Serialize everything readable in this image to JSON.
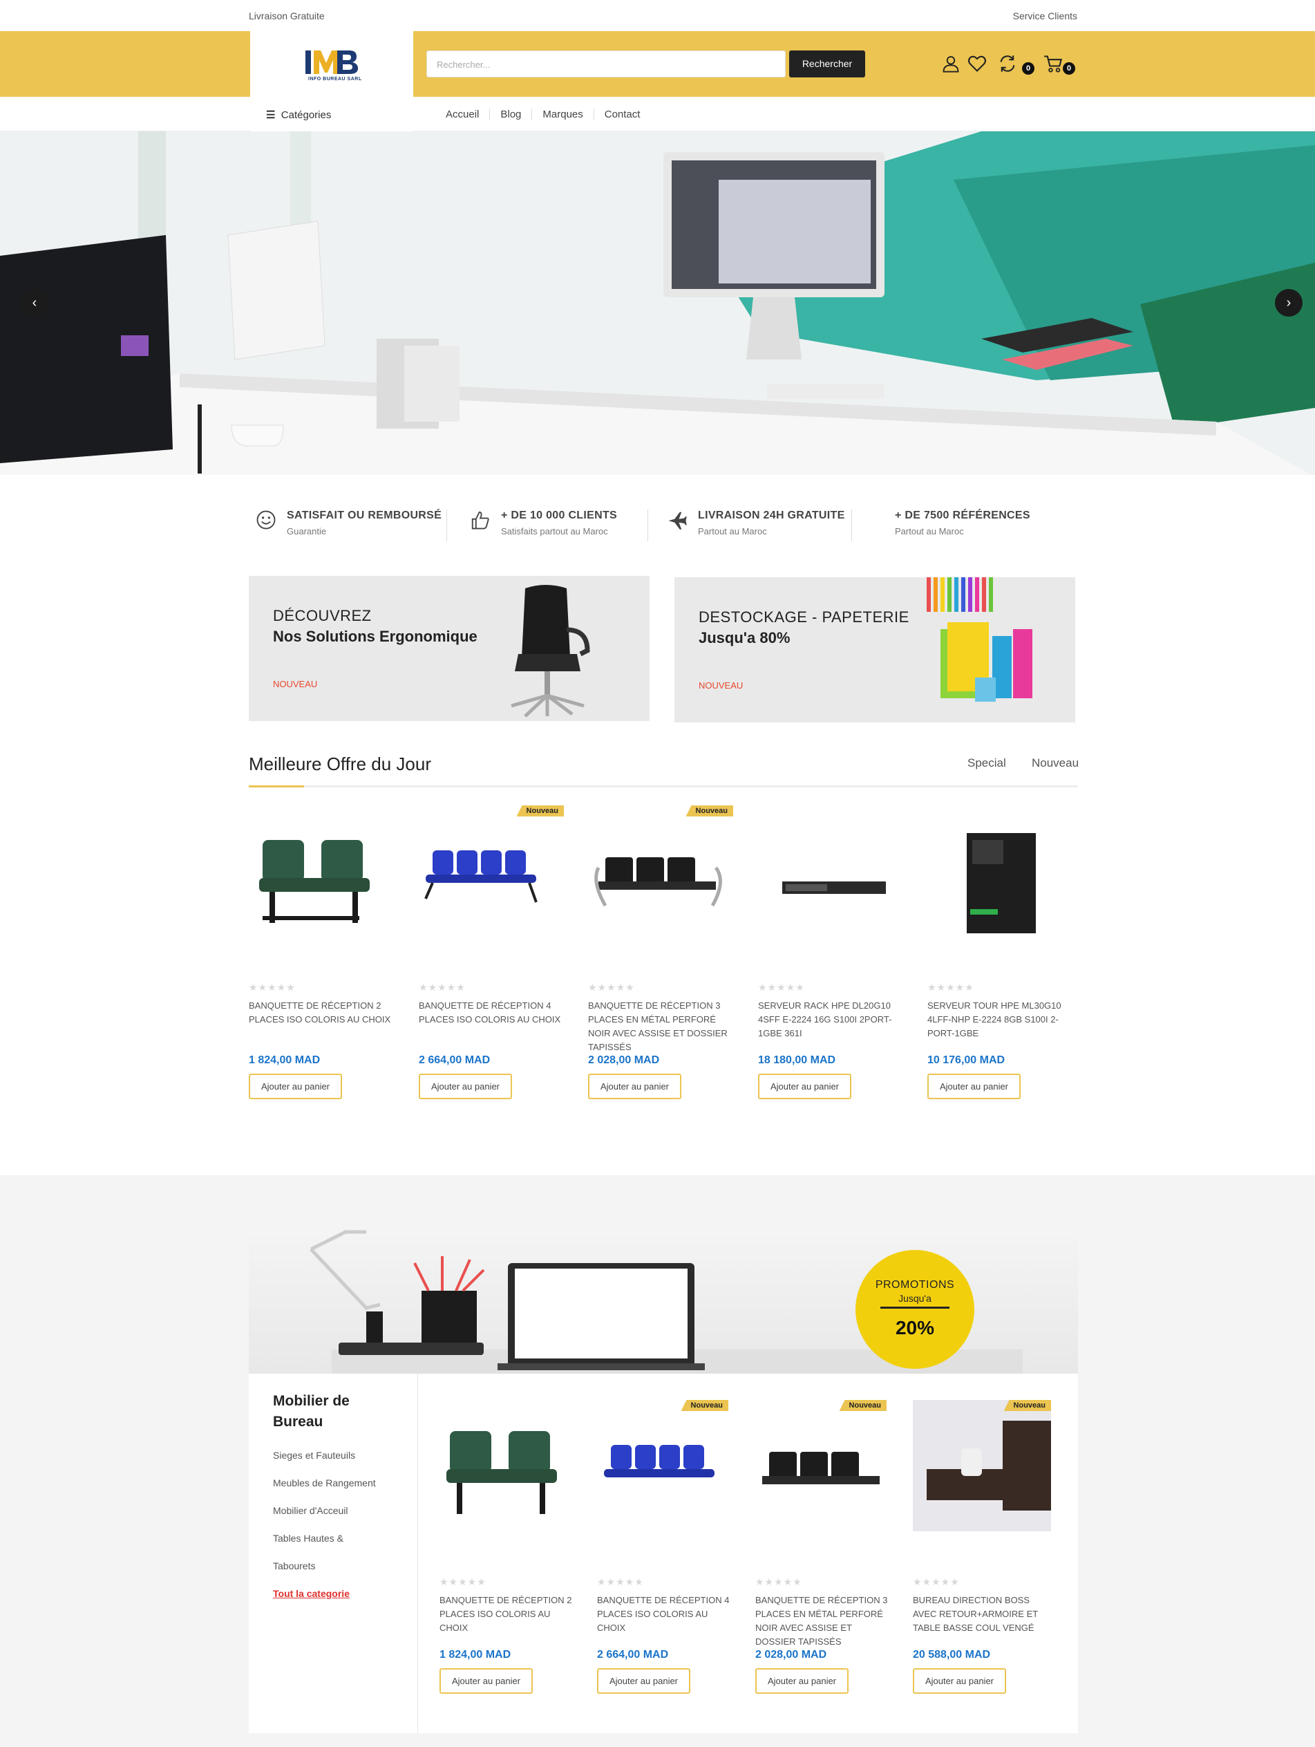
{
  "topbar": {
    "left": "Livraison Gratuite",
    "right": "Service Clients"
  },
  "header": {
    "logo_text": "IMB",
    "logo_sub": "INFO BUREAU SARL",
    "search_placeholder": "Rechercher...",
    "search_button": "Rechercher",
    "compare_count": "0",
    "cart_count": "0"
  },
  "nav": {
    "categories": "Catégories",
    "items": [
      "Accueil",
      "Blog",
      "Marques",
      "Contact"
    ]
  },
  "features": [
    {
      "title": "SATISFAIT OU REMBOURSÉ",
      "sub": "Guarantie",
      "icon": "smile-icon"
    },
    {
      "title": "+ DE 10 000 CLIENTS",
      "sub": "Satisfaits partout au Maroc",
      "icon": "thumbs-up-icon"
    },
    {
      "title": "LIVRAISON 24H GRATUITE",
      "sub": "Partout au Maroc",
      "icon": "plane-icon"
    },
    {
      "title": "+ DE 7500 RÉFÉRENCES",
      "sub": "Partout au Maroc",
      "icon": ""
    }
  ],
  "banners": [
    {
      "line1": "DÉCOUVREZ",
      "line2": "Nos Solutions Ergonomique",
      "tag": "NOUVEAU"
    },
    {
      "line1": "DESTOCKAGE - PAPETERIE",
      "line2": "Jusqu'a 80%",
      "tag": "NOUVEAU"
    }
  ],
  "deals": {
    "title": "Meilleure Offre du Jour",
    "tabs": [
      "Special",
      "Nouveau"
    ],
    "products": [
      {
        "name": "BANQUETTE DE RÉCEPTION 2 PLACES ISO COLORIS AU CHOIX",
        "price": "1 824,00 MAD",
        "button": "Ajouter au panier",
        "badge": ""
      },
      {
        "name": "BANQUETTE DE RÉCEPTION 4 PLACES ISO COLORIS AU CHOIX",
        "price": "2 664,00 MAD",
        "button": "Ajouter au panier",
        "badge": "Nouveau"
      },
      {
        "name": "BANQUETTE DE RÉCEPTION 3 PLACES EN MÉTAL PERFORÉ NOIR AVEC ASSISE ET DOSSIER TAPISSÉS",
        "price": "2 028,00 MAD",
        "button": "Ajouter au panier",
        "badge": "Nouveau"
      },
      {
        "name": "SERVEUR RACK HPE DL20G10 4SFF E-2224 16G S100I 2PORT-1GBE 361I",
        "price": "18 180,00 MAD",
        "button": "Ajouter au panier",
        "badge": ""
      },
      {
        "name": "SERVEUR TOUR HPE ML30G10 4LFF-NHP E-2224 8GB S100I 2-PORT-1GBE",
        "price": "10 176,00 MAD",
        "button": "Ajouter au panier",
        "badge": ""
      }
    ]
  },
  "promo": {
    "label": "PROMOTIONS",
    "sub": "Jusqu'a",
    "value": "20%"
  },
  "category": {
    "title": "Mobilier de Bureau",
    "links": [
      "Sieges et Fauteuils",
      "Meubles de Rangement",
      "Mobilier d'Acceuil",
      "Tables Hautes &",
      "Tabourets"
    ],
    "all": "Tout la categorie",
    "products": [
      {
        "name": "BANQUETTE DE RÉCEPTION 2 PLACES ISO COLORIS AU CHOIX",
        "price": "1 824,00 MAD",
        "button": "Ajouter au panier",
        "badge": ""
      },
      {
        "name": "BANQUETTE DE RÉCEPTION 4 PLACES ISO COLORIS AU CHOIX",
        "price": "2 664,00 MAD",
        "button": "Ajouter au panier",
        "badge": "Nouveau"
      },
      {
        "name": "BANQUETTE DE RÉCEPTION 3 PLACES EN MÉTAL PERFORÉ NOIR AVEC ASSISE ET DOSSIER TAPISSÉS",
        "price": "2 028,00 MAD",
        "button": "Ajouter au panier",
        "badge": "Nouveau"
      },
      {
        "name": "BUREAU DIRECTION BOSS AVEC RETOUR+ARMOIRE ET TABLE BASSE COUL VENGÉ",
        "price": "20 588,00 MAD",
        "button": "Ajouter au panier",
        "badge": "Nouveau"
      }
    ]
  },
  "colors": {
    "accent": "#ebc451",
    "price": "#1b74c9",
    "link_red": "#e02e2e",
    "promo_yellow": "#f2cf0d"
  }
}
